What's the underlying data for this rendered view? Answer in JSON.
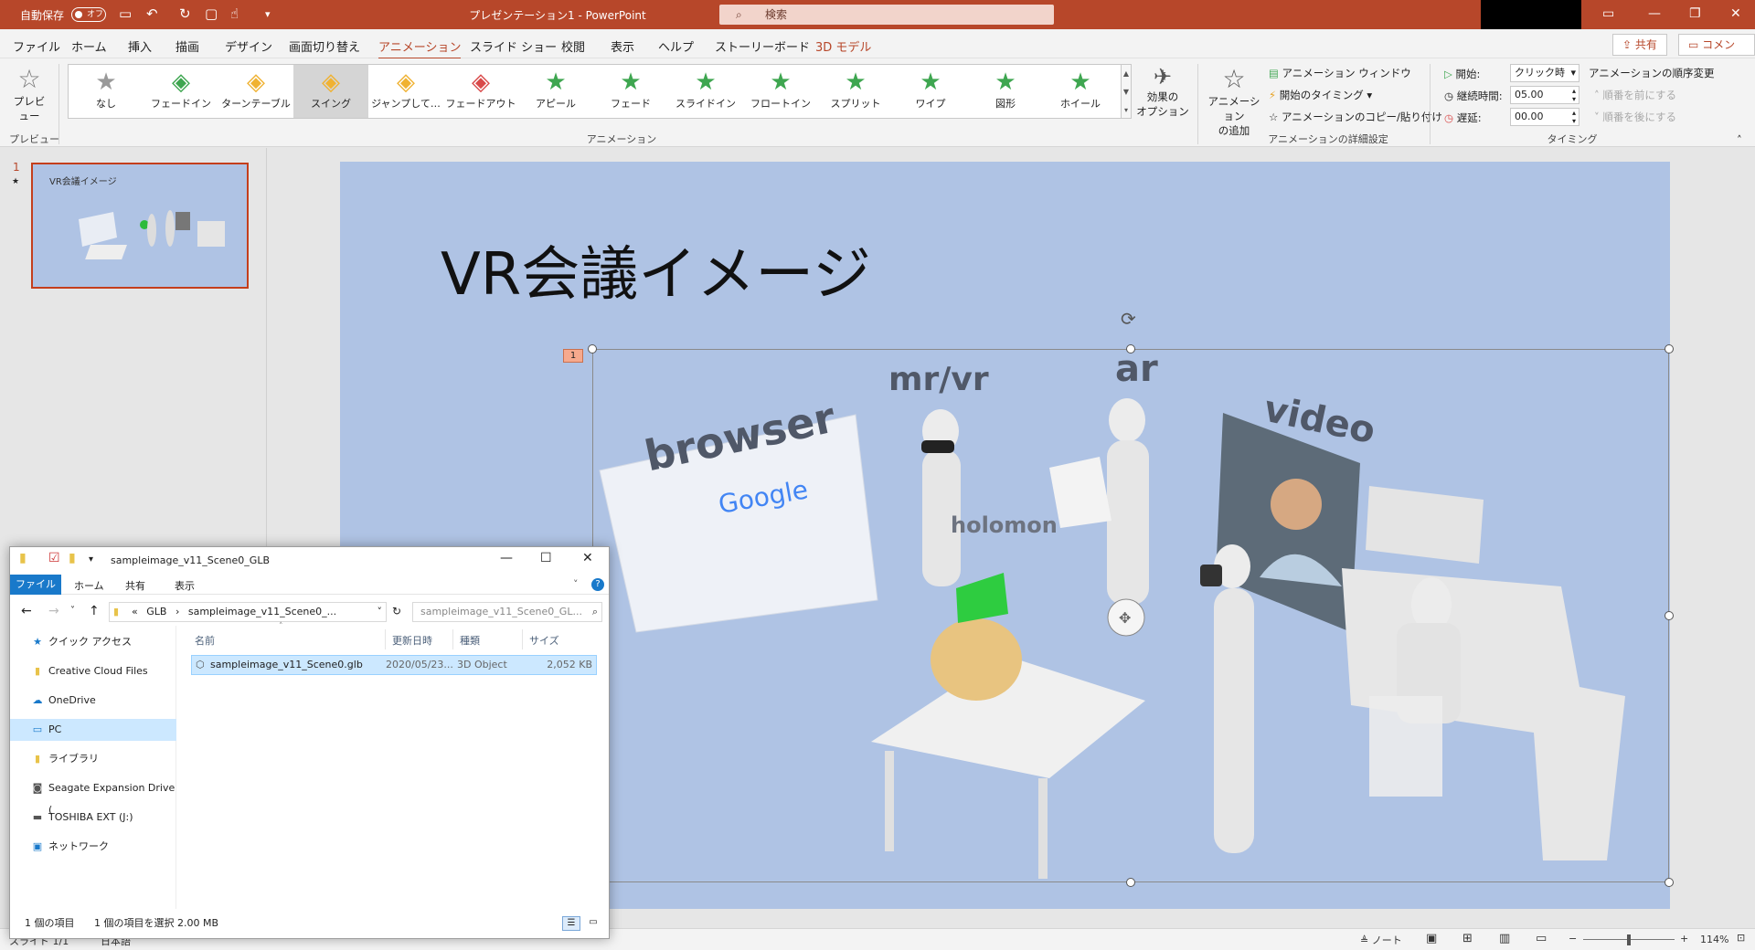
{
  "titlebar": {
    "autosave_label": "自動保存",
    "autosave_state": "オフ",
    "document_title": "プレゼンテーション1 - PowerPoint",
    "search_placeholder": "検索"
  },
  "tabs": [
    "ファイル",
    "ホーム",
    "挿入",
    "描画",
    "デザイン",
    "画面切り替え",
    "アニメーション",
    "スライド ショー",
    "校閲",
    "表示",
    "ヘルプ",
    "ストーリーボード",
    "3D モデル"
  ],
  "active_tab": "アニメーション",
  "share_label": "共有",
  "comment_label": "コメント",
  "ribbon": {
    "preview_label": "プレビュー",
    "preview_group": "プレビュー",
    "animations_group": "アニメーション",
    "animations": [
      {
        "label": "なし",
        "icon": "star-grey-icon"
      },
      {
        "label": "フェードイン",
        "icon": "cube-green-icon"
      },
      {
        "label": "ターンテーブル",
        "icon": "cube-yellow-icon"
      },
      {
        "label": "スイング",
        "icon": "cube-yellow-icon",
        "selected": true
      },
      {
        "label": "ジャンプして…",
        "icon": "cube-yellow-icon"
      },
      {
        "label": "フェードアウト",
        "icon": "cube-red-icon"
      },
      {
        "label": "アピール",
        "icon": "star-green-icon"
      },
      {
        "label": "フェード",
        "icon": "star-green-icon"
      },
      {
        "label": "スライドイン",
        "icon": "star-green-icon"
      },
      {
        "label": "フロートイン",
        "icon": "star-green-icon"
      },
      {
        "label": "スプリット",
        "icon": "star-green-icon"
      },
      {
        "label": "ワイプ",
        "icon": "star-green-icon"
      },
      {
        "label": "図形",
        "icon": "star-green-icon"
      },
      {
        "label": "ホイール",
        "icon": "star-green-icon"
      }
    ],
    "effect_options_line1": "効果の",
    "effect_options_line2": "オプション",
    "add_animation_line1": "アニメーション",
    "add_animation_line2": "の追加",
    "animation_pane": "アニメーション ウィンドウ",
    "trigger": "開始のタイミング",
    "animation_painter": "アニメーションのコピー/貼り付け",
    "advanced_group": "アニメーションの詳細設定",
    "start_label": "開始:",
    "start_value": "クリック時",
    "duration_label": "継続時間:",
    "duration_value": "05.00",
    "delay_label": "遅延:",
    "delay_value": "00.00",
    "reorder_label": "アニメーションの順序変更",
    "move_earlier": "順番を前にする",
    "move_later": "順番を後にする",
    "timing_group": "タイミング"
  },
  "thumbnail": {
    "number": "1",
    "star": "★",
    "title": "VR会議イメージ"
  },
  "slide": {
    "title": "VR会議イメージ",
    "anim_tag": "1",
    "labels": [
      "browser",
      "mr/vr",
      "ar",
      "video",
      "holomon"
    ],
    "browser_logo": "Google"
  },
  "explorer": {
    "title": "sampleimage_v11_Scene0_GLB",
    "ribbon_tabs": [
      "ファイル",
      "ホーム",
      "共有",
      "表示"
    ],
    "breadcrumb": [
      "«",
      "GLB",
      "›",
      "sampleimage_v11_Scene0_..."
    ],
    "search_placeholder": "sampleimage_v11_Scene0_GL...",
    "nav": [
      "クイック アクセス",
      "Creative Cloud Files",
      "OneDrive",
      "PC",
      "ライブラリ",
      "Seagate Expansion Drive (",
      "TOSHIBA EXT (J:)",
      "ネットワーク"
    ],
    "nav_selected": "PC",
    "columns": [
      "名前",
      "更新日時",
      "種類",
      "サイズ"
    ],
    "file": {
      "name": "sampleimage_v11_Scene0.glb",
      "date": "2020/05/23...",
      "type": "3D Object",
      "size": "2,052 KB"
    },
    "status_count": "1 個の項目",
    "status_selected": "1 個の項目を選択  2.00 MB"
  },
  "statusbar": {
    "slide": "スライド 1/1",
    "language": "日本語",
    "notes": "ノート",
    "zoom": "114%"
  }
}
